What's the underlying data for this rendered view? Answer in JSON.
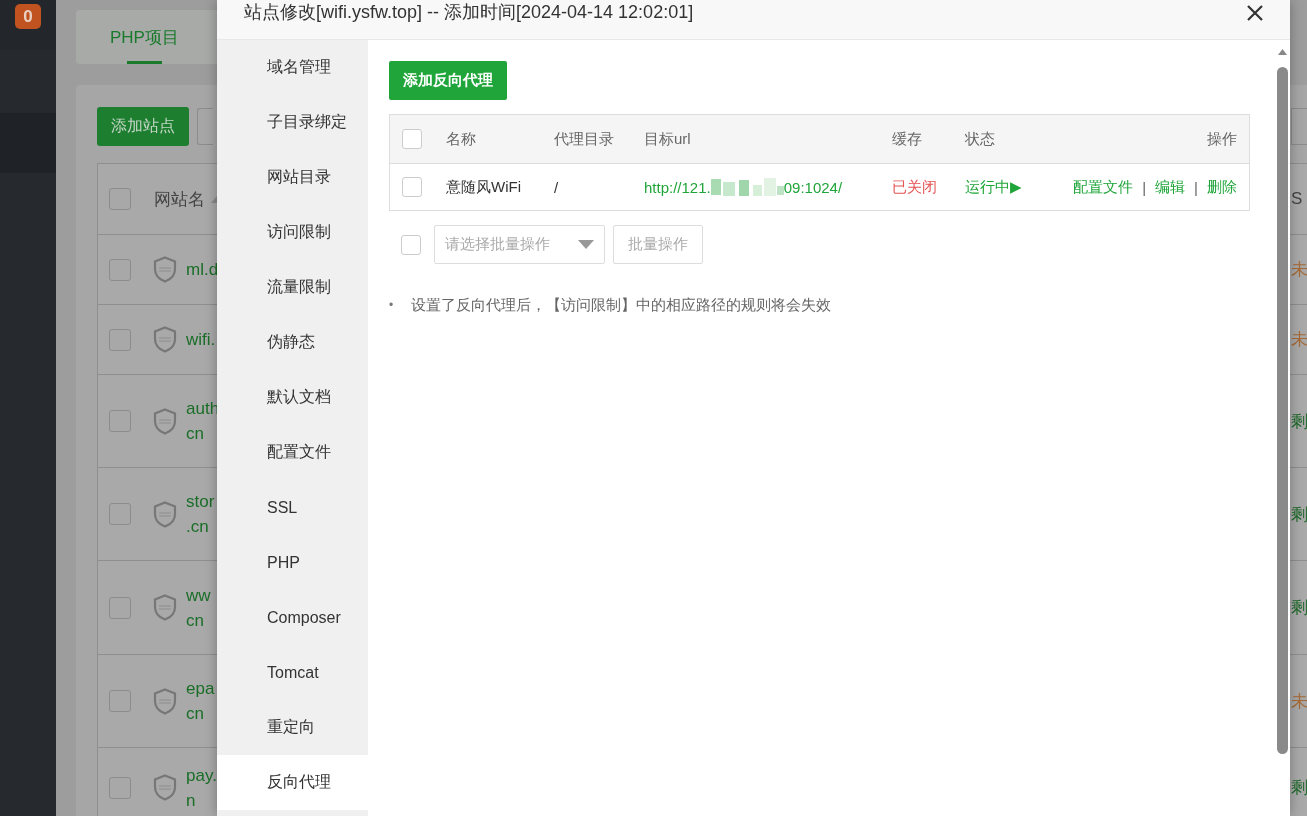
{
  "sidebar": {
    "badge": "0"
  },
  "page": {
    "tabs": [
      {
        "label": "PHP项目",
        "selected": true
      }
    ],
    "add_site_button": "添加站点",
    "table": {
      "header": {
        "checked": false,
        "site_name": "网站名",
        "column_fragment": "S"
      },
      "rows": [
        {
          "checked": false,
          "name": [
            "ml.d"
          ],
          "status_fragment": "未",
          "color": "#a66a36"
        },
        {
          "checked": false,
          "name": [
            "wifi."
          ],
          "status_fragment": "未",
          "color": "#a66a36"
        },
        {
          "checked": false,
          "name": [
            "auth",
            "cn"
          ],
          "status_fragment": "剩",
          "color": "#1e6a2a"
        },
        {
          "checked": false,
          "name": [
            "stor",
            ".cn"
          ],
          "status_fragment": "剩",
          "color": "#1e6a2a"
        },
        {
          "checked": false,
          "name": [
            "ww",
            "cn"
          ],
          "status_fragment": "剩",
          "color": "#1e6a2a"
        },
        {
          "checked": false,
          "name": [
            "epa",
            "cn"
          ],
          "status_fragment": "未",
          "color": "#a66a36"
        },
        {
          "checked": false,
          "name": [
            "pay.",
            "n"
          ],
          "status_fragment": "剩",
          "color": "#1e6a2a"
        }
      ]
    }
  },
  "dialog": {
    "title": "站点修改[wifi.ysfw.top] -- 添加时间[2024-04-14 12:02:01]",
    "menu": [
      {
        "label": "域名管理",
        "selected": false
      },
      {
        "label": "子目录绑定",
        "selected": false
      },
      {
        "label": "网站目录",
        "selected": false
      },
      {
        "label": "访问限制",
        "selected": false
      },
      {
        "label": "流量限制",
        "selected": false
      },
      {
        "label": "伪静态",
        "selected": false
      },
      {
        "label": "默认文档",
        "selected": false
      },
      {
        "label": "配置文件",
        "selected": false
      },
      {
        "label": "SSL",
        "selected": false
      },
      {
        "label": "PHP",
        "selected": false
      },
      {
        "label": "Composer",
        "selected": false
      },
      {
        "label": "Tomcat",
        "selected": false
      },
      {
        "label": "重定向",
        "selected": false
      },
      {
        "label": "反向代理",
        "selected": true
      }
    ],
    "add_button": "添加反向代理",
    "proxy_table": {
      "select_all": {
        "checked": false
      },
      "columns": [
        "名称",
        "代理目录",
        "目标url",
        "缓存",
        "状态",
        "操作"
      ],
      "rows": [
        {
          "checked": false,
          "name": "意随风WiFi",
          "directory": "/",
          "url_start": "http://121.",
          "url_end": "09:1024/",
          "cache": "已关闭",
          "cache_on": false,
          "status": "运行中▶",
          "running": true,
          "actions": [
            {
              "kind": "link",
              "label": "配置文件"
            },
            {
              "kind": "divider",
              "label": "|"
            },
            {
              "kind": "link",
              "label": "编辑"
            },
            {
              "kind": "divider",
              "label": "|"
            },
            {
              "kind": "link",
              "label": "删除"
            }
          ]
        }
      ]
    },
    "batch": {
      "checked": false,
      "placeholder": "请选择批量操作",
      "button": "批量操作",
      "disabled": true
    },
    "notes": [
      {
        "bullet": "•",
        "text": "设置了反向代理后，【访问限制】中的相应路径的规则将会失效"
      }
    ]
  }
}
